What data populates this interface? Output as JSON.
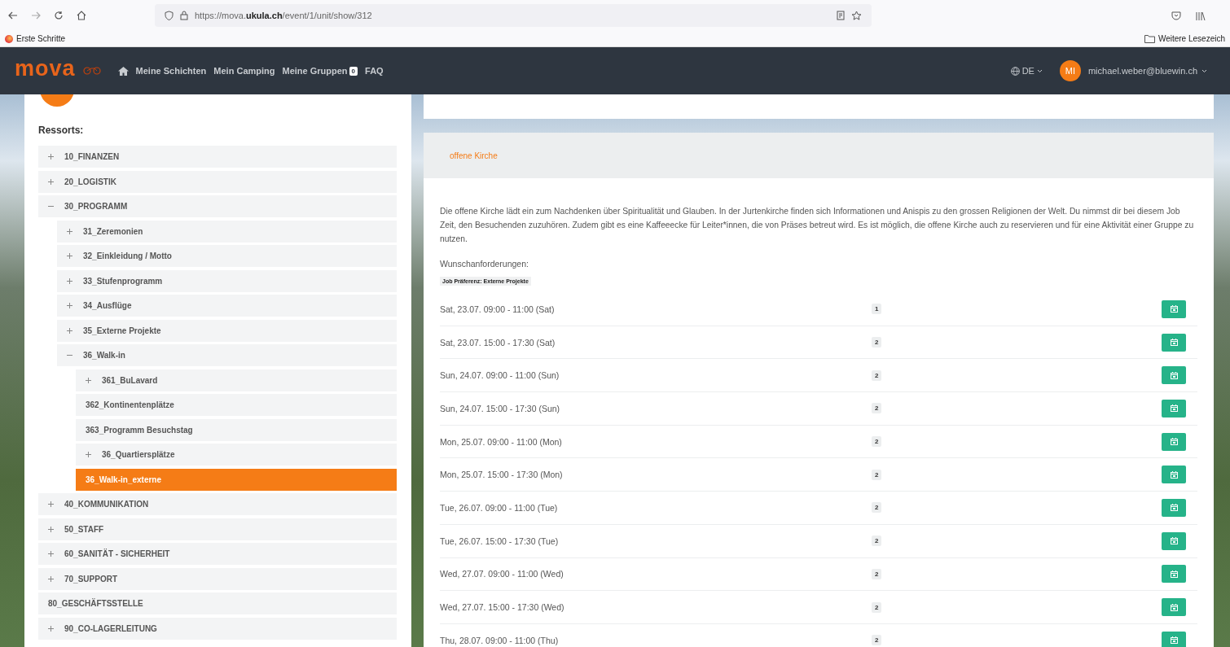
{
  "browser": {
    "url": "https://mova.**ukula.ch**/event/1/unit/show/312",
    "bookmarks": [
      "Erste Schritte"
    ],
    "other_bookmarks": "Weitere Lesezeich"
  },
  "navbar": {
    "logo": "mova",
    "links": [
      {
        "label": "Meine Schichten"
      },
      {
        "label": "Mein Camping"
      },
      {
        "label": "Meine Gruppen",
        "badge": "0"
      },
      {
        "label": "FAQ"
      }
    ],
    "language": "DE",
    "avatar": "MI",
    "user": "michael.weber@bluewin.ch"
  },
  "sidebar": {
    "heading": "Ressorts:",
    "tree": [
      {
        "label": "10_FINANZEN",
        "kind": "group",
        "expanded": false,
        "selected": false
      },
      {
        "label": "20_LOGISTIK",
        "kind": "group",
        "expanded": false,
        "selected": false
      },
      {
        "label": "30_PROGRAMM",
        "kind": "group",
        "expanded": true,
        "selected": false,
        "children": [
          {
            "label": "31_Zeremonien",
            "kind": "group",
            "expanded": false,
            "selected": false
          },
          {
            "label": "32_Einkleidung / Motto",
            "kind": "group",
            "expanded": false,
            "selected": false
          },
          {
            "label": "33_Stufenprogramm",
            "kind": "group",
            "expanded": false,
            "selected": false
          },
          {
            "label": "34_Ausflüge",
            "kind": "group",
            "expanded": false,
            "selected": false
          },
          {
            "label": "35_Externe Projekte",
            "kind": "group",
            "expanded": false,
            "selected": false
          },
          {
            "label": "36_Walk-in",
            "kind": "group",
            "expanded": true,
            "selected": false,
            "children": [
              {
                "label": "361_BuLavard",
                "kind": "group",
                "expanded": false,
                "selected": false
              },
              {
                "label": "362_Kontinentenplätze",
                "kind": "leaf",
                "selected": false
              },
              {
                "label": "363_Programm Besuchstag",
                "kind": "leaf",
                "selected": false
              },
              {
                "label": "36_Quartiersplätze",
                "kind": "group",
                "expanded": false,
                "selected": false
              },
              {
                "label": "36_Walk-in_externe",
                "kind": "leaf",
                "selected": true
              }
            ]
          }
        ]
      },
      {
        "label": "40_KOMMUNIKATION",
        "kind": "group",
        "expanded": false,
        "selected": false
      },
      {
        "label": "50_STAFF",
        "kind": "group",
        "expanded": false,
        "selected": false
      },
      {
        "label": "60_SANITÄT - SICHERHEIT",
        "kind": "group",
        "expanded": false,
        "selected": false
      },
      {
        "label": "70_SUPPORT",
        "kind": "group",
        "expanded": false,
        "selected": false
      },
      {
        "label": "80_GESCHÄFTSSTELLE",
        "kind": "leaf",
        "selected": false
      },
      {
        "label": "90_CO-LAGERLEITUNG",
        "kind": "group",
        "expanded": false,
        "selected": false
      }
    ]
  },
  "unit": {
    "title": "offene Kirche",
    "description": "Die offene Kirche lädt ein zum Nachdenken über Spiritualität und Glauben. In der Jurtenkirche finden sich Informationen und Anispis zu den grossen Religionen der Welt. Du nimmst dir bei diesem Job Zeit, den Besuchenden zuzuhören. Zudem gibt es eine Kaffeeecke für Leiter*innen, die von Präses betreut wird. Es ist möglich, die offene Kirche auch zu reservieren und für eine Aktivität einer Gruppe zu nutzen.",
    "requirements_label": "Wunschanforderungen:",
    "requirement_tags": [
      "Job Präferenz: Externe Projekte"
    ],
    "shifts": [
      {
        "time": "Sat, 23.07. 09:00 - 11:00 (Sat)",
        "count": "1"
      },
      {
        "time": "Sat, 23.07. 15:00 - 17:30 (Sat)",
        "count": "2"
      },
      {
        "time": "Sun, 24.07. 09:00 - 11:00 (Sun)",
        "count": "2"
      },
      {
        "time": "Sun, 24.07. 15:00 - 17:30 (Sun)",
        "count": "2"
      },
      {
        "time": "Mon, 25.07. 09:00 - 11:00 (Mon)",
        "count": "2"
      },
      {
        "time": "Mon, 25.07. 15:00 - 17:30 (Mon)",
        "count": "2"
      },
      {
        "time": "Tue, 26.07. 09:00 - 11:00 (Tue)",
        "count": "2"
      },
      {
        "time": "Tue, 26.07. 15:00 - 17:30 (Tue)",
        "count": "2"
      },
      {
        "time": "Wed, 27.07. 09:00 - 11:00 (Wed)",
        "count": "2"
      },
      {
        "time": "Wed, 27.07. 15:00 - 17:30 (Wed)",
        "count": "2"
      },
      {
        "time": "Thu, 28.07. 09:00 - 11:00 (Thu)",
        "count": "2"
      }
    ]
  }
}
